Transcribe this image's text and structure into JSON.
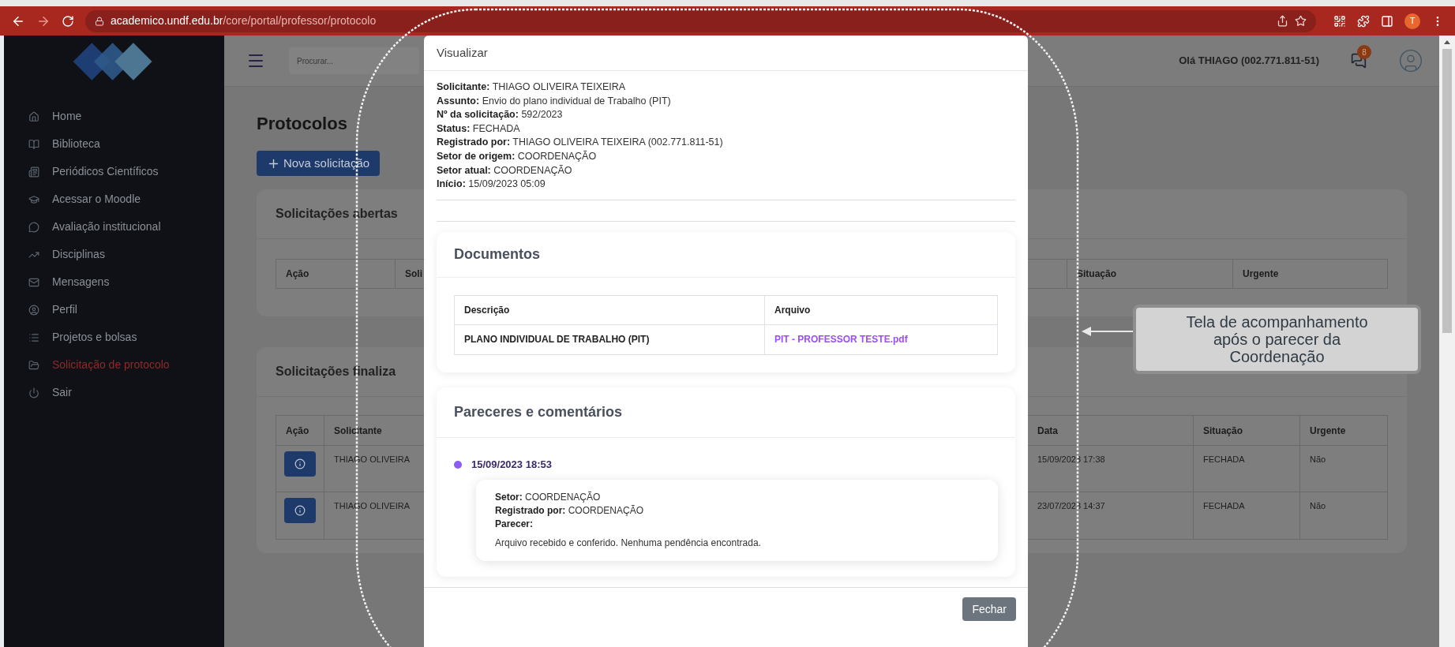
{
  "browser": {
    "url_host": "academico.undf.edu.br",
    "url_path": "/core/portal/professor/protocolo",
    "profile_initial": "T"
  },
  "sidebar": {
    "items": [
      {
        "label": "Home",
        "selected": false
      },
      {
        "label": "Biblioteca",
        "selected": false
      },
      {
        "label": "Periódicos Científicos",
        "selected": false
      },
      {
        "label": "Acessar o Moodle",
        "selected": false
      },
      {
        "label": "Avaliação institucional",
        "selected": false
      },
      {
        "label": "Disciplinas",
        "selected": false
      },
      {
        "label": "Mensagens",
        "selected": false
      },
      {
        "label": "Perfil",
        "selected": false
      },
      {
        "label": "Projetos e bolsas",
        "selected": false
      },
      {
        "label": "Solicitação de protocolo",
        "selected": true
      },
      {
        "label": "Sair",
        "selected": false
      }
    ]
  },
  "header": {
    "search_placeholder": "Procurar...",
    "greeting": "Olá THIAGO (002.771.811-51)",
    "notification_count": "8"
  },
  "page": {
    "title": "Protocolos",
    "new_button": "Nova solicitação",
    "open_requests": {
      "title": "Solicitações abertas",
      "columns": [
        "Ação",
        "Soli",
        "Situação",
        "Urgente"
      ]
    },
    "closed_requests": {
      "title": "Solicitações finaliza",
      "columns": [
        "Ação",
        "Solicitante",
        "Data",
        "Situação",
        "Urgente"
      ],
      "rows": [
        {
          "solicitante": "THIAGO OLIVEIRA",
          "data": "15/09/2023 17:38",
          "situacao": "FECHADA",
          "urgente": "Não"
        },
        {
          "solicitante": "THIAGO OLIVEIRA",
          "data": "23/07/2023 14:37",
          "situacao": "FECHADA",
          "urgente": "Não"
        }
      ]
    }
  },
  "modal": {
    "title": "Visualizar",
    "fields": [
      {
        "label": "Solicitante:",
        "value": "THIAGO OLIVEIRA TEIXEIRA"
      },
      {
        "label": "Assunto:",
        "value": "Envio do plano individual de Trabalho (PIT)"
      },
      {
        "label": "Nº da solicitação:",
        "value": "592/2023"
      },
      {
        "label": "Status:",
        "value": "FECHADA"
      },
      {
        "label": "Registrado por:",
        "value": "THIAGO OLIVEIRA TEIXEIRA (002.771.811-51)"
      },
      {
        "label": "Setor de origem:",
        "value": "COORDENAÇÃO"
      },
      {
        "label": "Setor atual:",
        "value": "COORDENAÇÃO"
      },
      {
        "label": "Início:",
        "value": "15/09/2023 05:09"
      }
    ],
    "documents": {
      "title": "Documentos",
      "columns": [
        "Descrição",
        "Arquivo"
      ],
      "rows": [
        {
          "descricao": "PLANO INDIVIDUAL DE TRABALHO (PIT)",
          "arquivo": "PIT - PROFESSOR TESTE.pdf"
        }
      ]
    },
    "comments": {
      "title": "Pareceres e comentários",
      "entries": [
        {
          "datetime": "15/09/2023 18:53",
          "color": "#8b5cf6",
          "fields": [
            {
              "label": "Setor:",
              "value": "COORDENAÇÃO"
            },
            {
              "label": "Registrado por:",
              "value": "COORDENAÇÃO"
            },
            {
              "label": "Parecer:"
            }
          ],
          "text": "Arquivo recebido e conferido. Nenhuma pendência encontrada."
        }
      ]
    },
    "close_button": "Fechar"
  },
  "annotation": {
    "text": "Tela de acompanhamento após o parecer da Coordenação"
  }
}
